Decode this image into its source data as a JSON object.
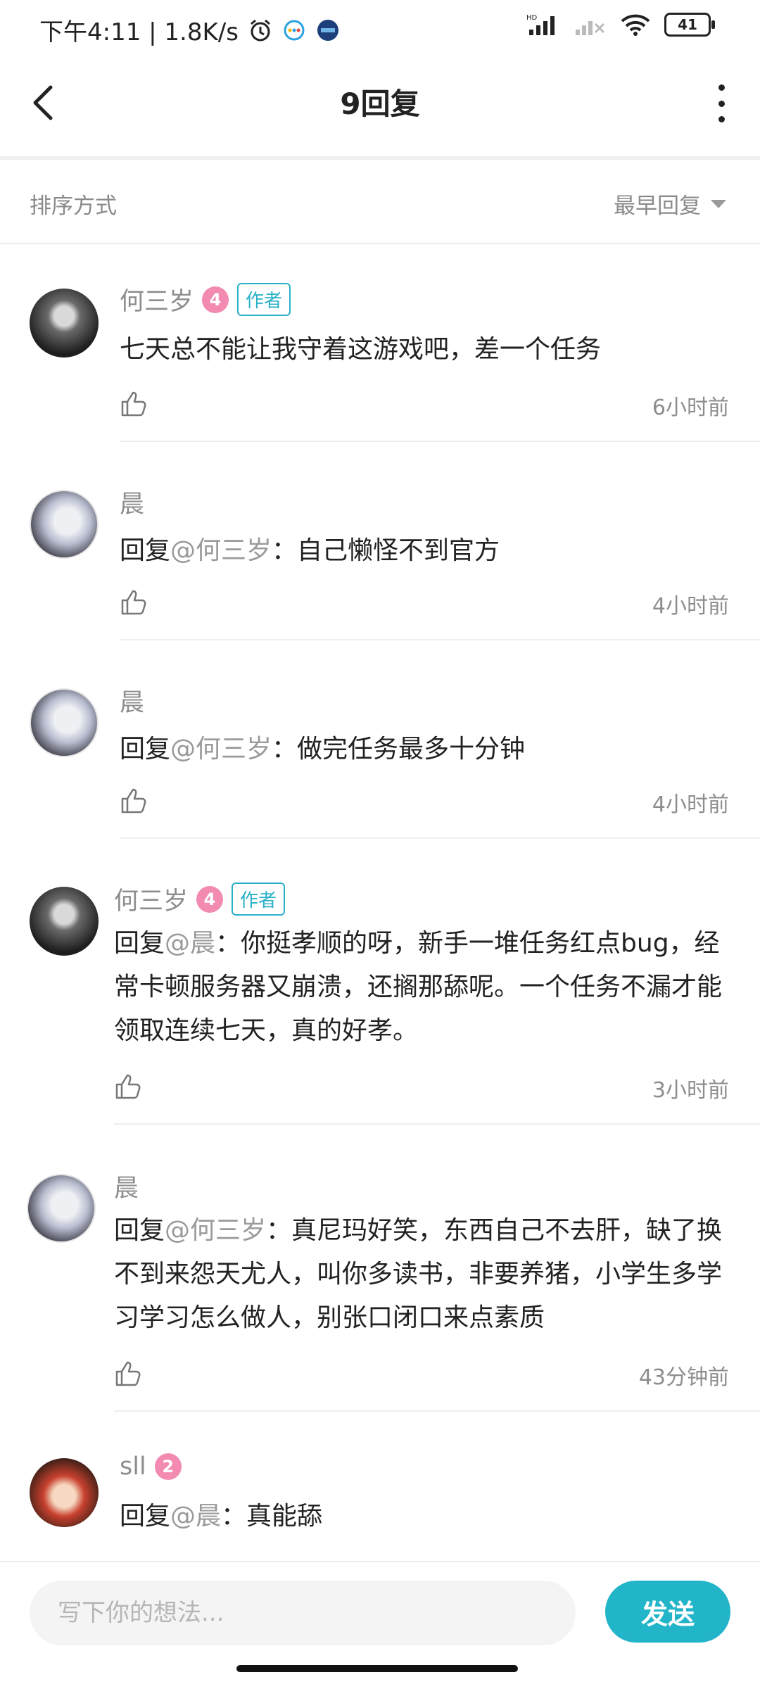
{
  "status_bar": {
    "time_speed": "下午4:11 | 1.8K/s",
    "battery": "41"
  },
  "header": {
    "title": "9回复"
  },
  "sort": {
    "label": "排序方式",
    "selected": "最早回复"
  },
  "comments": [
    {
      "name": "何三岁",
      "level": "4",
      "badge": "作者",
      "reply_prefix": "",
      "mention": "",
      "text": "七天总不能让我守着这游戏吧，差一个任务",
      "time": "6小时前"
    },
    {
      "name": "晨",
      "reply_prefix": "回复",
      "mention": "@何三岁",
      "text": "：自己懒怪不到官方",
      "time": "4小时前"
    },
    {
      "name": "晨",
      "reply_prefix": "回复",
      "mention": "@何三岁",
      "text": "：做完任务最多十分钟",
      "time": "4小时前"
    },
    {
      "name": "何三岁",
      "level": "4",
      "badge": "作者",
      "reply_prefix": "回复",
      "mention": "@晨",
      "text": "：你挺孝顺的呀，新手一堆任务红点bug，经常卡顿服务器又崩溃，还搁那舔呢。一个任务不漏才能领取连续七天，真的好孝。",
      "time": "3小时前"
    },
    {
      "name": "晨",
      "reply_prefix": "回复",
      "mention": "@何三岁",
      "text": "：真尼玛好笑，东西自己不去肝，缺了换不到来怨天尤人，叫你多读书，非要养猪，小学生多学习学习怎么做人，别张口闭口来点素质",
      "time": "43分钟前"
    },
    {
      "name": "sll",
      "level": "2",
      "reply_prefix": "回复",
      "mention": "@晨",
      "text": "：真能舔"
    }
  ],
  "composer": {
    "placeholder": "写下你的想法...",
    "send_label": "发送"
  }
}
